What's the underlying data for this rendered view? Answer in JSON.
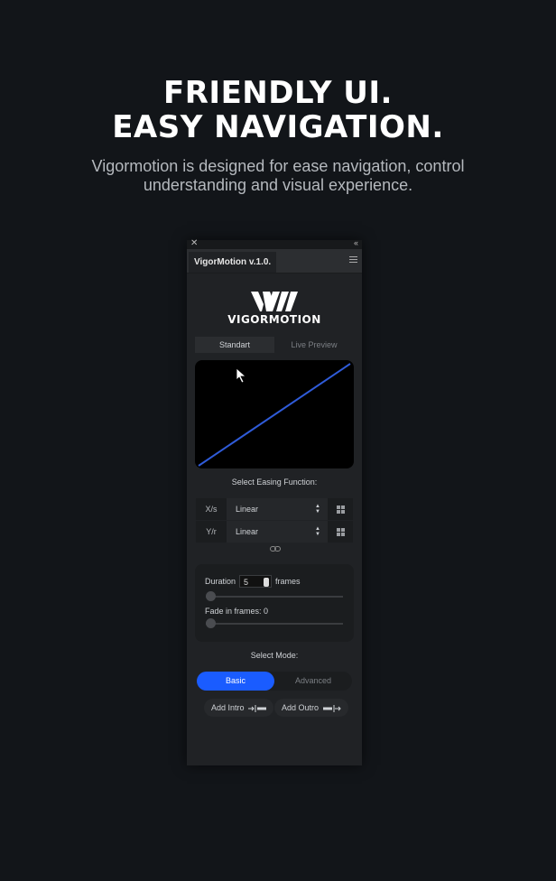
{
  "hero": {
    "line1": "FRIENDLY UI.",
    "line2": "EASY NAVIGATION.",
    "subtitle": "Vigormotion is designed for ease navigation, control understanding and visual experience."
  },
  "panel": {
    "close_glyph": "✕",
    "collapse_glyph": "‹‹",
    "tab_title": "VigorMotion v.1.0.",
    "menu_icon": "hamburger-icon",
    "logo_text": "VIGORMOTION",
    "view_tabs": [
      {
        "label": "Standart",
        "active": true
      },
      {
        "label": "Live Preview",
        "active": false
      }
    ],
    "easing_heading": "Select Easing Function:",
    "easing_rows": [
      {
        "axis": "X/s",
        "value": "Linear"
      },
      {
        "axis": "Y/r",
        "value": "Linear"
      }
    ],
    "duration_label": "Duration",
    "duration_value": "5",
    "duration_unit": "frames",
    "duration_slider_value": 0,
    "fade_label": "Fade in frames: 0",
    "fade_slider_value": 0,
    "mode_heading": "Select Mode:",
    "modes": [
      {
        "label": "Basic",
        "active": true
      },
      {
        "label": "Advanced",
        "active": false
      }
    ],
    "add_intro": "Add Intro",
    "add_outro": "Add Outro",
    "curve_color": "#2f5bd8",
    "accent": "#1a5cff"
  }
}
